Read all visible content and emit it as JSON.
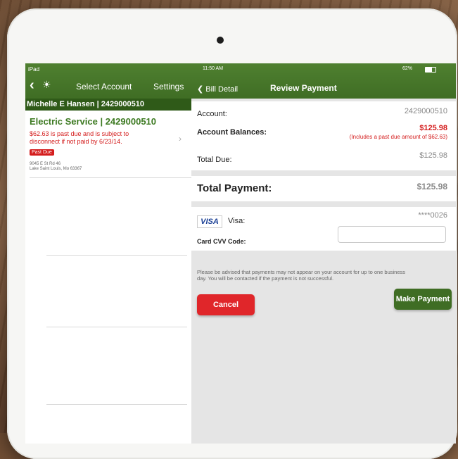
{
  "status_bar": {
    "device": "iPad",
    "time": "11:50 AM",
    "battery": "62%"
  },
  "left_pane": {
    "back_icon": "chevron-left-icon",
    "logo_icon": "sun-icon",
    "title": "Select Account",
    "settings_label": "Settings",
    "account_header": "Michelle E Hansen | 2429000510",
    "service": {
      "title": "Electric Service | 2429000510",
      "warning": "$62.63 is past due and is subject to disconnect if not paid by 6/23/14.",
      "badge": "Past Due",
      "address_line1": "9045 E St Rd 46",
      "address_line2": "Lake Saint Louis, Mo 63367"
    }
  },
  "right_pane": {
    "back_label": "Bill Detail",
    "title": "Review Payment",
    "account_label": "Account:",
    "account_value": "2429000510",
    "balances_label": "Account Balances:",
    "balances_value": "$125.98",
    "balances_note": "(Includes a past due amount of $62.63)",
    "total_due_label": "Total Due:",
    "total_due_value": "$125.98",
    "total_payment_label": "Total Payment:",
    "total_payment_value": "$125.98",
    "card_brand": "VISA",
    "card_label": "Visa:",
    "card_number": "****0026",
    "cvv_label": "Card CVV Code:",
    "cvv_value": "",
    "notice": "Please be advised that payments may not appear on your account for up to one business day. You will be contacted if the payment is not successful.",
    "cancel_label": "Cancel",
    "pay_label": "Make Payment"
  },
  "colors": {
    "brand_green": "#3f6d24",
    "dark_green": "#2f5a18",
    "alert_red": "#d41d1d"
  }
}
